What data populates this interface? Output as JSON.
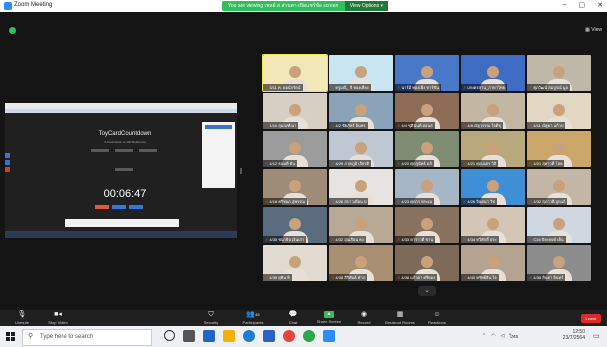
{
  "window": {
    "title": "Zoom Meeting",
    "controls": [
      "–",
      "▢",
      "✕"
    ]
  },
  "share_banner": {
    "text": "You are viewing เพลย์ ส ส่วนตา เปิดแชร์ข้อ screen",
    "view_options": "View Options ▾"
  },
  "view_label": "View",
  "shared_screen": {
    "title": "ToyCardCountdown",
    "subtitle": "A Countdown to 100 Bedrooms",
    "countdown": "00:06:47",
    "label1": "Hours",
    "label2": "Minutes",
    "label3": "Seconds"
  },
  "participants": [
    {
      "name": "3/11 ค. ดอน์กรัตน์",
      "active": true,
      "bg": "#f3e9b8"
    },
    {
      "name": "ครูมณี_ จี ทองเที่ยง",
      "active": false,
      "bg": "#c9e4f1"
    },
    {
      "name": "นาร์มี ทองเพ็ง ชาร์ชัน",
      "active": false,
      "bg": "#4a78c8"
    },
    {
      "name": "เกษตรสาน_ภาษาไทย",
      "active": false,
      "bg": "#3e6cc2"
    },
    {
      "name": "ศุภวัฒน์ สมบูรณ์ มูล",
      "active": false,
      "bg": "#bfb7a8"
    },
    {
      "name": "1/10 สุมณฑ์ณา",
      "active": false,
      "bg": "#d8cfc4"
    },
    {
      "name": "4/2 ชัยภัทร์ อินทร",
      "active": false,
      "bg": "#8aa3b8"
    },
    {
      "name": "4/4 ชุตินันท์ อ่อนส",
      "active": false,
      "bg": "#8d6b55"
    },
    {
      "name": "4/8 ณัฐวรรณ ใจดีชุ",
      "active": false,
      "bg": "#c3b6a2"
    },
    {
      "name": "4/11 ณัฐยา แก้วป",
      "active": false,
      "bg": "#e2d7c3"
    },
    {
      "name": "4/12 ธนบดี ตัน",
      "active": false,
      "bg": "#9b9b9b"
    },
    {
      "name": "4/29 ภาคภูมิ เกียรติ",
      "active": false,
      "bg": "#bfc8d2"
    },
    {
      "name": "4/20 ศุภสุนัทธ์ อภิ",
      "active": false,
      "bg": "#7e8c73"
    },
    {
      "name": "4/21 ศุภเนตร วิสิ",
      "active": false,
      "bg": "#b9a87c"
    },
    {
      "name": "4/21 สุดาวดี โฮย",
      "active": false,
      "bg": "#caa66a"
    },
    {
      "name": "4/18 ศรีชนก สุพรรณ",
      "active": false,
      "bg": "#9f8c78"
    },
    {
      "name": "4/26 สกาวเดือน ป",
      "active": false,
      "bg": "#e6e3e0"
    },
    {
      "name": "4/23 ศุภกร พระเม",
      "active": false,
      "bg": "#a7b6c4"
    },
    {
      "name": "4/26 จินตนา วิช",
      "active": false,
      "bg": "#3e8fd6"
    },
    {
      "name": "4/32 สุภาวดี ลูกแก้",
      "active": false,
      "bg": "#c4b6a6"
    },
    {
      "name": "4/35 ชนาธิป เงินเก่า",
      "active": false,
      "bg": "#5a6b7e"
    },
    {
      "name": "4/32 อุ่นเรือน คง",
      "active": false,
      "bg": "#b7a995"
    },
    {
      "name": "4/33 ดาราวดี ข่าน",
      "active": false,
      "bg": "#8a7260"
    },
    {
      "name": "4/34 ทวีศักดิ์ ประ",
      "active": false,
      "bg": "#d4c6b6"
    },
    {
      "name": "C34 ปิยะพงษ์ เย็น",
      "active": false,
      "bg": "#cfd7e0"
    },
    {
      "name": "4/35 ยุพิน หิ",
      "active": false,
      "bg": "#e2dbd2"
    },
    {
      "name": "4/38 สิริพันธ์ คำภ",
      "active": false,
      "bg": "#a88f72"
    },
    {
      "name": "4/38 แก้วตา ศรีทอง",
      "active": false,
      "bg": "#7d6a58"
    },
    {
      "name": "4/40 ทรัพย์สิน ใจ",
      "active": false,
      "bg": "#b3a390"
    },
    {
      "name": "4/36 ลินดา อินทร์",
      "active": false,
      "bg": "#8d8d8d"
    }
  ],
  "toolbar": {
    "unmute": "Unmute",
    "stop_video": "Stop Video",
    "security": "Security",
    "participants": "Participants",
    "participants_count": "45",
    "chat": "Chat",
    "share_screen": "Share Screen",
    "record": "Record",
    "breakout": "Breakout Rooms",
    "reactions": "Reactions",
    "leave": "Leave"
  },
  "taskbar": {
    "search_placeholder": "Type here to search",
    "language": "ไทย",
    "time": "12:50",
    "date": "23/7/2564"
  }
}
